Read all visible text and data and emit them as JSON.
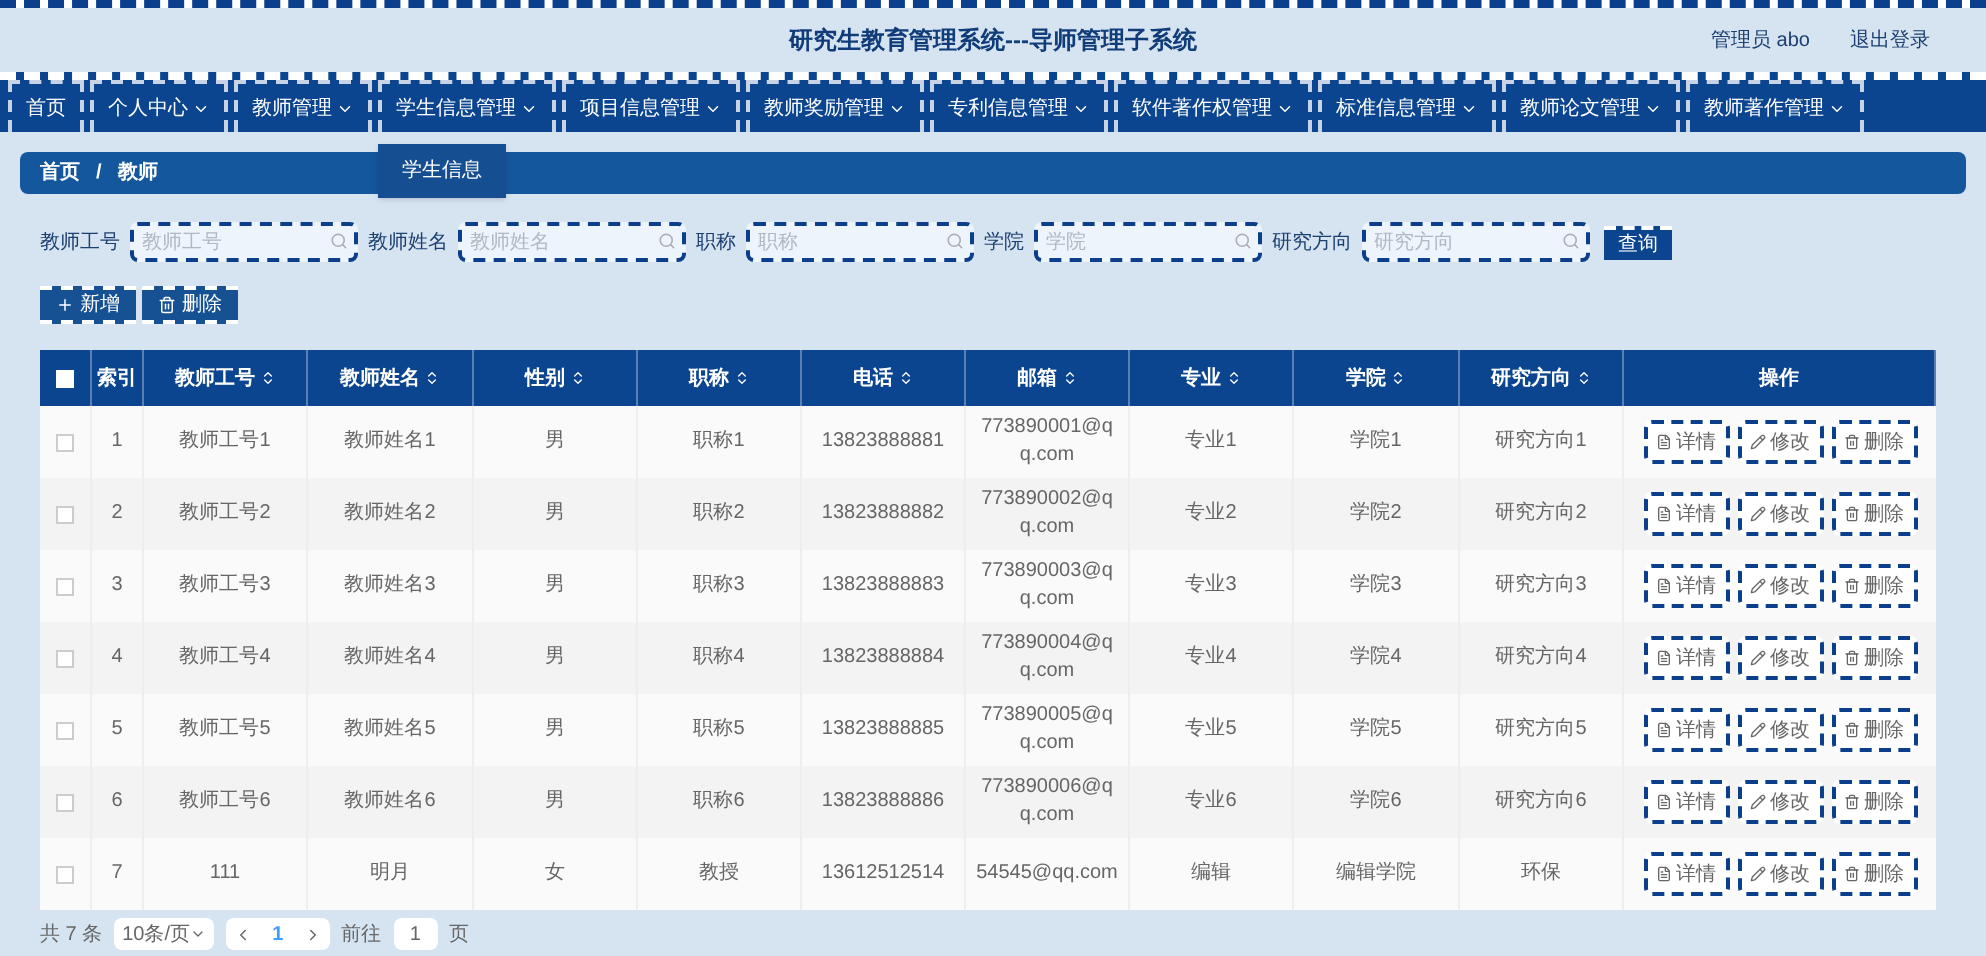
{
  "header": {
    "title": "研究生教育管理系统---导师管理子系统",
    "user": "管理员 abo",
    "logout": "退出登录"
  },
  "nav": [
    {
      "label": "首页",
      "has_menu": false
    },
    {
      "label": "个人中心",
      "has_menu": true
    },
    {
      "label": "教师管理",
      "has_menu": true
    },
    {
      "label": "学生信息管理",
      "has_menu": true,
      "menu": [
        "学生信息"
      ]
    },
    {
      "label": "项目信息管理",
      "has_menu": true
    },
    {
      "label": "教师奖励管理",
      "has_menu": true
    },
    {
      "label": "专利信息管理",
      "has_menu": true
    },
    {
      "label": "软件著作权管理",
      "has_menu": true
    },
    {
      "label": "标准信息管理",
      "has_menu": true
    },
    {
      "label": "教师论文管理",
      "has_menu": true
    },
    {
      "label": "教师著作管理",
      "has_menu": true
    }
  ],
  "breadcrumb": [
    "首页",
    "教师"
  ],
  "breadcrumb_separator": "/",
  "filters": [
    {
      "label": "教师工号",
      "placeholder": "教师工号"
    },
    {
      "label": "教师姓名",
      "placeholder": "教师姓名"
    },
    {
      "label": "职称",
      "placeholder": "职称"
    },
    {
      "label": "学院",
      "placeholder": "学院"
    },
    {
      "label": "研究方向",
      "placeholder": "研究方向"
    }
  ],
  "search_button": "查询",
  "actions": [
    {
      "label": "新增",
      "kind": "add"
    },
    {
      "label": "删除",
      "kind": "delete"
    }
  ],
  "table": {
    "columns": [
      {
        "label": "索引",
        "sortable": false
      },
      {
        "label": "教师工号",
        "sortable": true
      },
      {
        "label": "教师姓名",
        "sortable": true
      },
      {
        "label": "性别",
        "sortable": true
      },
      {
        "label": "职称",
        "sortable": true
      },
      {
        "label": "电话",
        "sortable": true
      },
      {
        "label": "邮箱",
        "sortable": true
      },
      {
        "label": "专业",
        "sortable": true
      },
      {
        "label": "学院",
        "sortable": true
      },
      {
        "label": "研究方向",
        "sortable": true
      },
      {
        "label": "操作",
        "sortable": false
      }
    ],
    "all_checked": false,
    "rows": [
      {
        "checked": false,
        "cells": [
          "1",
          "教师工号1",
          "教师姓名1",
          "男",
          "职称1",
          "13823888881",
          "773890001@qq.com",
          "专业1",
          "学院1",
          "研究方向1"
        ],
        "actions": [
          {
            "label": "详情",
            "kind": "detail"
          },
          {
            "label": "修改",
            "kind": "edit"
          },
          {
            "label": "删除",
            "kind": "delete"
          }
        ]
      },
      {
        "checked": false,
        "cells": [
          "2",
          "教师工号2",
          "教师姓名2",
          "男",
          "职称2",
          "13823888882",
          "773890002@qq.com",
          "专业2",
          "学院2",
          "研究方向2"
        ],
        "actions": [
          {
            "label": "详情",
            "kind": "detail"
          },
          {
            "label": "修改",
            "kind": "edit"
          },
          {
            "label": "删除",
            "kind": "delete"
          }
        ]
      },
      {
        "checked": false,
        "cells": [
          "3",
          "教师工号3",
          "教师姓名3",
          "男",
          "职称3",
          "13823888883",
          "773890003@qq.com",
          "专业3",
          "学院3",
          "研究方向3"
        ],
        "actions": [
          {
            "label": "详情",
            "kind": "detail"
          },
          {
            "label": "修改",
            "kind": "edit"
          },
          {
            "label": "删除",
            "kind": "delete"
          }
        ]
      },
      {
        "checked": false,
        "cells": [
          "4",
          "教师工号4",
          "教师姓名4",
          "男",
          "职称4",
          "13823888884",
          "773890004@qq.com",
          "专业4",
          "学院4",
          "研究方向4"
        ],
        "actions": [
          {
            "label": "详情",
            "kind": "detail"
          },
          {
            "label": "修改",
            "kind": "edit"
          },
          {
            "label": "删除",
            "kind": "delete"
          }
        ]
      },
      {
        "checked": false,
        "cells": [
          "5",
          "教师工号5",
          "教师姓名5",
          "男",
          "职称5",
          "13823888885",
          "773890005@qq.com",
          "专业5",
          "学院5",
          "研究方向5"
        ],
        "actions": [
          {
            "label": "详情",
            "kind": "detail"
          },
          {
            "label": "修改",
            "kind": "edit"
          },
          {
            "label": "删除",
            "kind": "delete"
          }
        ]
      },
      {
        "checked": false,
        "cells": [
          "6",
          "教师工号6",
          "教师姓名6",
          "男",
          "职称6",
          "13823888886",
          "773890006@qq.com",
          "专业6",
          "学院6",
          "研究方向6"
        ],
        "actions": [
          {
            "label": "详情",
            "kind": "detail"
          },
          {
            "label": "修改",
            "kind": "edit"
          },
          {
            "label": "删除",
            "kind": "delete"
          }
        ]
      },
      {
        "checked": false,
        "cells": [
          "7",
          "111",
          "明月",
          "女",
          "教授",
          "13612512514",
          "54545@qq.com",
          "编辑",
          "编辑学院",
          "环保"
        ],
        "actions": [
          {
            "label": "详情",
            "kind": "detail"
          },
          {
            "label": "修改",
            "kind": "edit"
          },
          {
            "label": "删除",
            "kind": "delete"
          }
        ]
      }
    ]
  },
  "pagination": {
    "total": "共 7 条",
    "page_size": "10条/页",
    "pages": [
      {
        "label": "1",
        "selected": true
      }
    ],
    "goto_label": "前往",
    "goto_value": "1",
    "goto_suffix": "页"
  }
}
